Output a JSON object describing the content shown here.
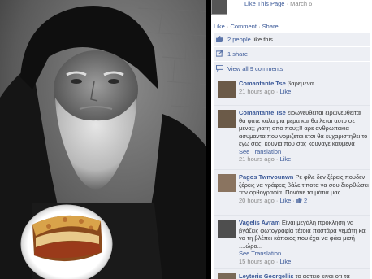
{
  "post": {
    "like_page": "Like This Page",
    "date": "March 6"
  },
  "actions": {
    "like": "Like",
    "comment": "Comment",
    "share": "Share",
    "separator": "·"
  },
  "summary": {
    "likes_link": "2 people",
    "likes_text": "like this.",
    "shares": "1 share",
    "view_comments": "View all 9 comments"
  },
  "comments": [
    {
      "name": "Comantante Tse",
      "text": "βαρεμενα",
      "time": "21 hours ago",
      "like": "Like",
      "separator": "·"
    },
    {
      "name": "Comantante Tse",
      "text": "ειρωνευθειται ειρωνευθειται θα φατε καλα μια μερα και θα λεται αυτο σε μενα;; γιατη απο που;;!! αρε ανθρωπακια ασυμαντα που νομιζεται ετσι θα ευχαριστηθει το εγω σας! κουνια που σας κουναγε καυμενα",
      "see_translation": "See Translation",
      "time": "21 hours ago",
      "like": "Like",
      "separator": "·"
    },
    {
      "name": "Pagos Twnvounwn",
      "text": "Ρε φίλε δεν ξέρεις πουδεν ξέρεις να γράφεις βάλε τίποτα να σου διορθώσει την ορθογραφία. Πονάνε τα μάτια μας.",
      "time": "20 hours ago",
      "like": "Like",
      "like_count": "2",
      "separator": "·"
    },
    {
      "name": "Vagelis Avram",
      "text": "Είναι μεγάλη πρόκληση να βγάζεις φωτογραφία τέτοια παστάρα γεμάτη και να τη βλέπει κάποιος που έχει να φάει μισή ....ώρα...",
      "see_translation": "See Translation",
      "time": "15 hours ago",
      "like": "Like",
      "separator": "·"
    },
    {
      "name": "Leyteris Georgellis",
      "text": "το αστειο ειναι οτι τα"
    }
  ],
  "colors": {
    "link": "#3b5998",
    "panel": "#edeff4",
    "meta": "#888888"
  },
  "icons": {
    "likes": "thumbs-up-icon",
    "shares": "share-icon",
    "comments": "comment-bubble-icon"
  }
}
